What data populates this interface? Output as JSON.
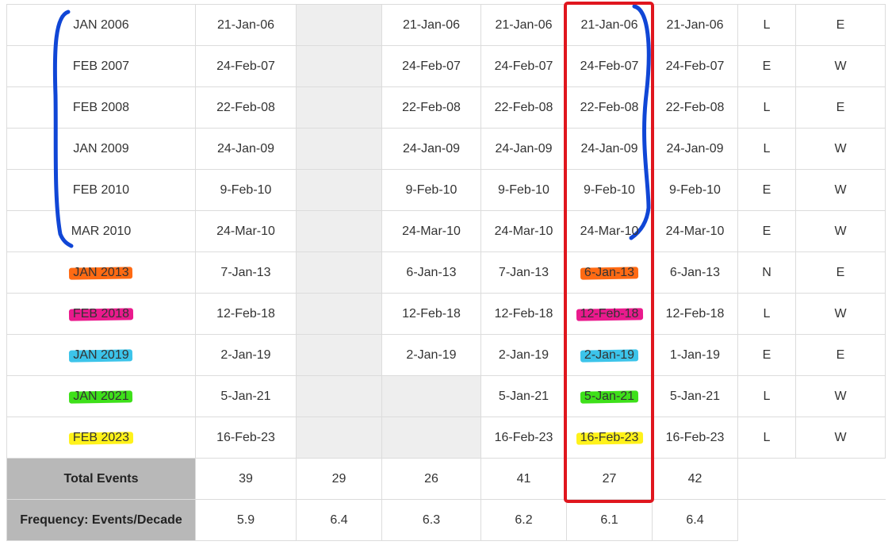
{
  "colors": {
    "row_highlights": [
      "",
      "",
      "",
      "",
      "",
      "",
      "#ff6a13",
      "#ea1a8d",
      "#3cc4ea",
      "#3ee01a",
      "#fff21a"
    ],
    "annotation_blue": "#1046d6",
    "annotation_red": "#e0161e",
    "header_gray": "#b8b8b8",
    "empty_gray": "#eeeeee"
  },
  "rows": [
    {
      "label": "JAN 2006",
      "cells": [
        "21-Jan-06",
        "",
        "21-Jan-06",
        "21-Jan-06",
        "21-Jan-06",
        "21-Jan-06",
        "L",
        "E"
      ],
      "gray": [
        false,
        true,
        false,
        false,
        false,
        false,
        false,
        false
      ]
    },
    {
      "label": "FEB 2007",
      "cells": [
        "24-Feb-07",
        "",
        "24-Feb-07",
        "24-Feb-07",
        "24-Feb-07",
        "24-Feb-07",
        "E",
        "W"
      ],
      "gray": [
        false,
        true,
        false,
        false,
        false,
        false,
        false,
        false
      ]
    },
    {
      "label": "FEB 2008",
      "cells": [
        "22-Feb-08",
        "",
        "22-Feb-08",
        "22-Feb-08",
        "22-Feb-08",
        "22-Feb-08",
        "L",
        "E"
      ],
      "gray": [
        false,
        true,
        false,
        false,
        false,
        false,
        false,
        false
      ]
    },
    {
      "label": "JAN 2009",
      "cells": [
        "24-Jan-09",
        "",
        "24-Jan-09",
        "24-Jan-09",
        "24-Jan-09",
        "24-Jan-09",
        "L",
        "W"
      ],
      "gray": [
        false,
        true,
        false,
        false,
        false,
        false,
        false,
        false
      ]
    },
    {
      "label": "FEB 2010",
      "cells": [
        "9-Feb-10",
        "",
        "9-Feb-10",
        "9-Feb-10",
        "9-Feb-10",
        "9-Feb-10",
        "E",
        "W"
      ],
      "gray": [
        false,
        true,
        false,
        false,
        false,
        false,
        false,
        false
      ]
    },
    {
      "label": "MAR 2010",
      "cells": [
        "24-Mar-10",
        "",
        "24-Mar-10",
        "24-Mar-10",
        "24-Mar-10",
        "24-Mar-10",
        "E",
        "W"
      ],
      "gray": [
        false,
        true,
        false,
        false,
        false,
        false,
        false,
        false
      ]
    },
    {
      "label": "JAN 2013",
      "cells": [
        "7-Jan-13",
        "",
        "6-Jan-13",
        "7-Jan-13",
        "6-Jan-13",
        "6-Jan-13",
        "N",
        "E"
      ],
      "gray": [
        false,
        true,
        false,
        false,
        false,
        false,
        false,
        false
      ]
    },
    {
      "label": "FEB 2018",
      "cells": [
        "12-Feb-18",
        "",
        "12-Feb-18",
        "12-Feb-18",
        "12-Feb-18",
        "12-Feb-18",
        "L",
        "W"
      ],
      "gray": [
        false,
        true,
        false,
        false,
        false,
        false,
        false,
        false
      ]
    },
    {
      "label": "JAN 2019",
      "cells": [
        "2-Jan-19",
        "",
        "2-Jan-19",
        "2-Jan-19",
        "2-Jan-19",
        "1-Jan-19",
        "E",
        "E"
      ],
      "gray": [
        false,
        true,
        false,
        false,
        false,
        false,
        false,
        false
      ]
    },
    {
      "label": "JAN 2021",
      "cells": [
        "5-Jan-21",
        "",
        "",
        "5-Jan-21",
        "5-Jan-21",
        "5-Jan-21",
        "L",
        "W"
      ],
      "gray": [
        false,
        true,
        true,
        false,
        false,
        false,
        false,
        false
      ]
    },
    {
      "label": "FEB 2023",
      "cells": [
        "16-Feb-23",
        "",
        "",
        "16-Feb-23",
        "16-Feb-23",
        "16-Feb-23",
        "L",
        "W"
      ],
      "gray": [
        false,
        true,
        true,
        false,
        false,
        false,
        false,
        false
      ]
    }
  ],
  "summary": [
    {
      "label": "Total Events",
      "values": [
        "39",
        "29",
        "26",
        "41",
        "27",
        "42"
      ]
    },
    {
      "label": "Frequency: Events/Decade",
      "values": [
        "5.9",
        "6.4",
        "6.3",
        "6.2",
        "6.1",
        "6.4"
      ]
    }
  ]
}
